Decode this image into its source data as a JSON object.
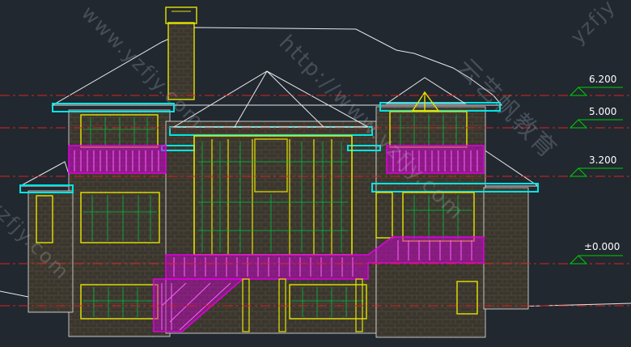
{
  "drawing": {
    "levels": [
      {
        "label": "6.200"
      },
      {
        "label": "5.000"
      },
      {
        "label": "3.200"
      },
      {
        "label": "±0.000"
      }
    ],
    "watermarks": {
      "url": "http://www.yzfjy.com",
      "brand": "云艺帆教育",
      "url_short": "www.yzfjy.com",
      "domain": "yzfjy.com",
      "domain_short": "yzfjy"
    },
    "colors": {
      "background": "#212830",
      "outline": "#ffffff",
      "trim": "#00e5e5",
      "window": "#e5e500",
      "glazing_bar": "#00c040",
      "railing": "#e000e0",
      "level_line": "#e02020",
      "level_marker": "#00d000",
      "stone": "#3f3a30"
    }
  }
}
